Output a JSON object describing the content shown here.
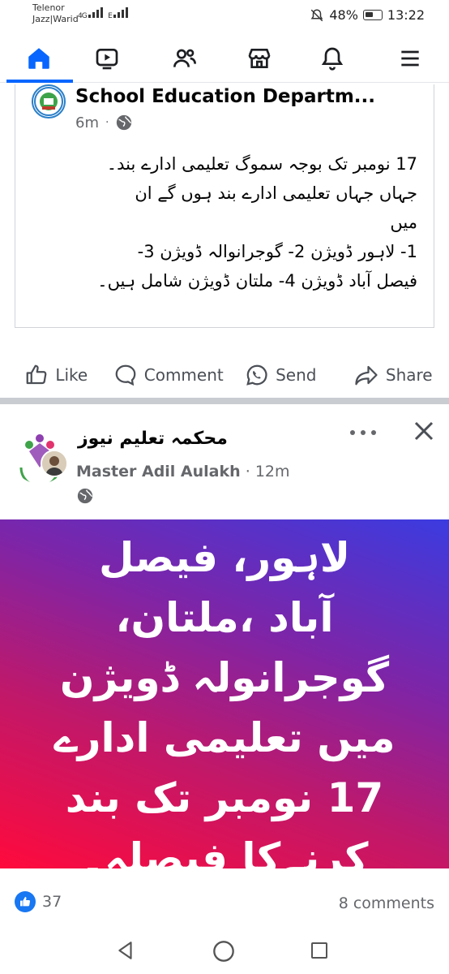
{
  "status_bar": {
    "carrier_1": "Telenor",
    "carrier_2": "Jazz|Warid",
    "network_1": "4G",
    "network_2": "E",
    "battery": "48%",
    "time": "13:22"
  },
  "nav": {
    "items": [
      "home",
      "video",
      "friends",
      "marketplace",
      "notifications",
      "menu"
    ],
    "active": "home"
  },
  "post1": {
    "page_name": "School Education Departm...",
    "time": "6m",
    "text": "17 نومبر تک بوجہ سموگ تعلیمی ادارے بند۔\nجہاں جہاں تعلیمی ادارے بند ہوں گے ان\nمیں\n1- لاہور ڈویژن  2- گوجرانوالہ ڈویژن 3-\nفیصل آباد ڈویژن 4- ملتان ڈویژن شامل ہیں۔",
    "actions": {
      "like": "Like",
      "comment": "Comment",
      "send": "Send",
      "share": "Share"
    }
  },
  "post2": {
    "group_name": "محکمہ تعلیم نیوز",
    "author": "Master Adil Aulakh",
    "separator": "·",
    "time": "12m",
    "banner_text": "لاہور، فیصل\nآباد ،ملتان،\nگوجرانولہ ڈویژن\nمیں تعلیمی ادارے\n17 نومبر تک بند\nکرنےکا فیصلہ۔",
    "reaction_count": "37",
    "comments": "8 comments"
  },
  "colors": {
    "accent": "#0866ff",
    "banner_start": "#ff0a3c",
    "banner_end": "#3b3be0"
  }
}
